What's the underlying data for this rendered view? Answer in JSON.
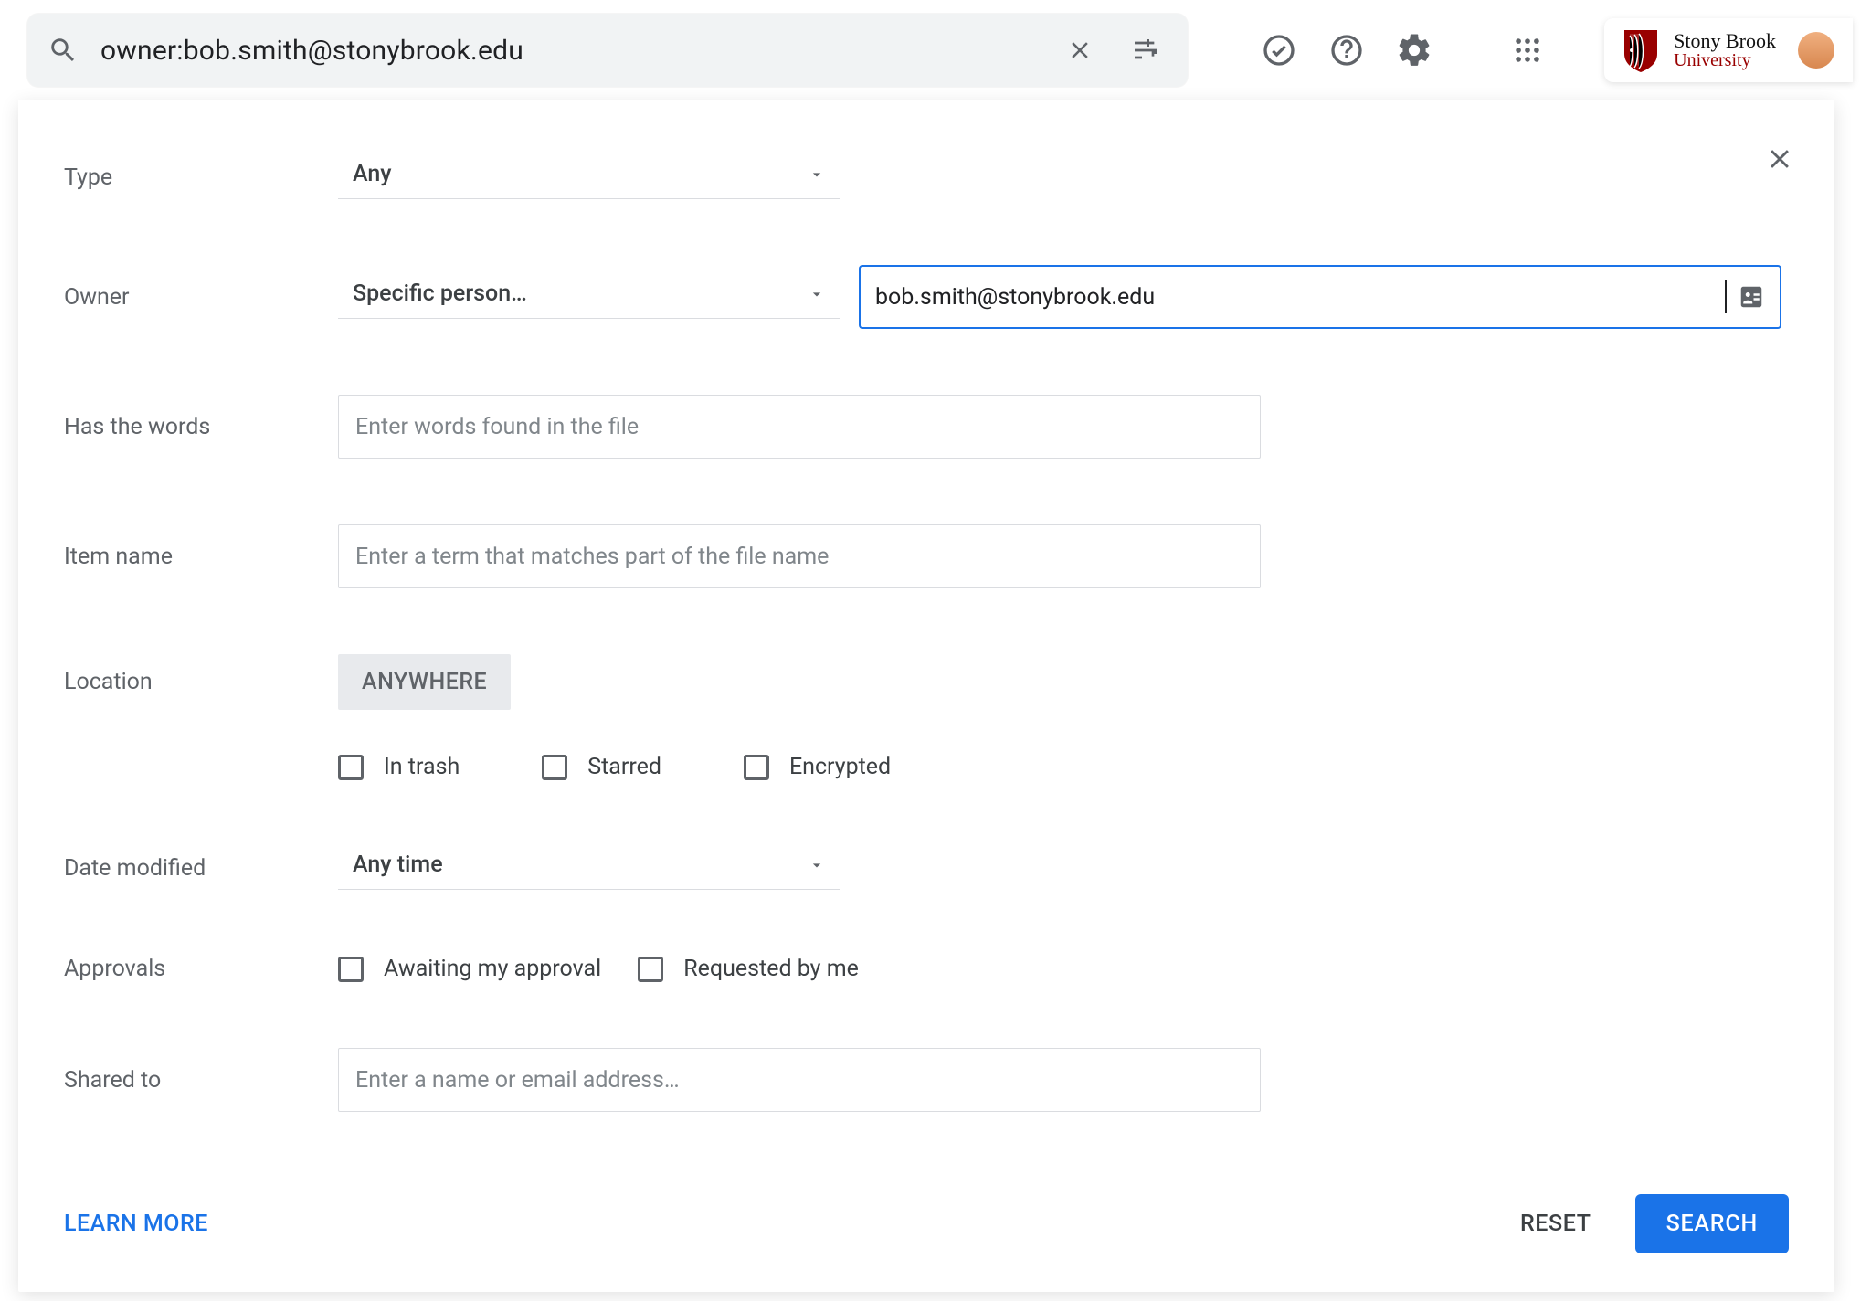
{
  "search": {
    "query": "owner:bob.smith@stonybrook.edu"
  },
  "brand": {
    "line1": "Stony Brook",
    "line2": "University"
  },
  "form": {
    "type": {
      "label": "Type",
      "value": "Any"
    },
    "owner": {
      "label": "Owner",
      "value": "Specific person…",
      "email": "bob.smith@stonybrook.edu"
    },
    "words": {
      "label": "Has the words",
      "placeholder": "Enter words found in the file"
    },
    "itemname": {
      "label": "Item name",
      "placeholder": "Enter a term that matches part of the file name"
    },
    "location": {
      "label": "Location",
      "value": "ANYWHERE"
    },
    "loc_opts": {
      "trash": "In trash",
      "starred": "Starred",
      "encrypted": "Encrypted"
    },
    "date": {
      "label": "Date modified",
      "value": "Any time"
    },
    "approvals": {
      "label": "Approvals",
      "awaiting": "Awaiting my approval",
      "requested": "Requested by me"
    },
    "shared": {
      "label": "Shared to",
      "placeholder": "Enter a name or email address…"
    }
  },
  "footer": {
    "learn": "LEARN MORE",
    "reset": "RESET",
    "search": "SEARCH"
  }
}
